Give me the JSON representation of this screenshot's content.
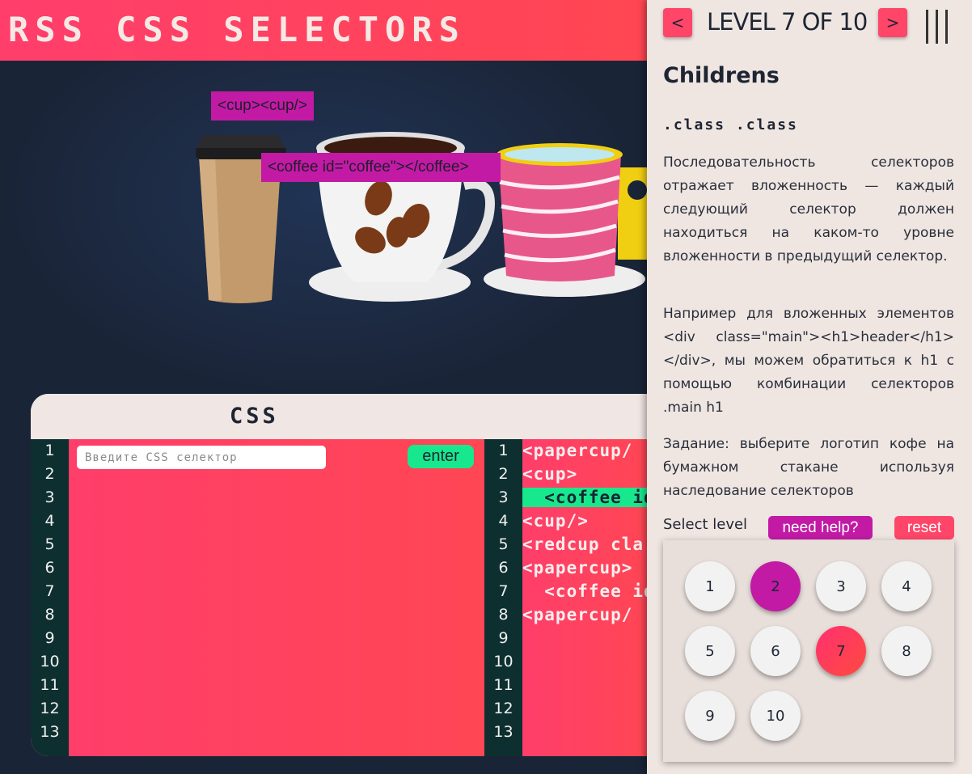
{
  "header": {
    "title": "RSS CSS SELECTORS"
  },
  "stage": {
    "tooltip_cup": "<cup><cup/>",
    "tooltip_coffee": "<coffee id=\"coffee\"></coffee>"
  },
  "editor": {
    "css_title": "CSS",
    "line_numbers": [
      "1",
      "2",
      "3",
      "4",
      "5",
      "6",
      "7",
      "8",
      "9",
      "10",
      "11",
      "12",
      "13"
    ],
    "input_placeholder": "Введите CSS селектор",
    "enter_label": "enter",
    "html_lines": [
      "<papercup/",
      "<cup>",
      "  <coffee id",
      "<cup/>",
      "<redcup cla",
      "<papercup>",
      "  <coffee id",
      "<papercup/"
    ]
  },
  "panel": {
    "prev_label": "<",
    "next_label": ">",
    "level_title": "LEVEL 7 OF 10",
    "menu_icon": "menu-icon",
    "level_name": "Childrens",
    "selector": ".class .class",
    "para1": "Последовательность селекторов отражает вложенность — каждый следующий селектор должен находиться на каком-то уровне вложенности в предыдущий селектор.",
    "para2": "Например для вложенных элементов <div class=\"main\"><h1>header</h1></div>, мы можем обратиться к h1 с помощью комбинации селекторов .main h1",
    "para3": "Задание: выберите логотип кофе на бумажном стакане используя наследование селекторов",
    "select_label": "Select level",
    "help_label": "need help?",
    "reset_label": "reset",
    "levels": [
      "1",
      "2",
      "3",
      "4",
      "5",
      "6",
      "7",
      "8",
      "9",
      "10"
    ],
    "completed_level": "2",
    "current_level": "7"
  },
  "colors": {
    "accent_pink": "#ff4669",
    "accent_magenta": "#c21aa5",
    "accent_green": "#18e88d",
    "background_dark": "#1a2437",
    "panel_bg": "#efe6e2"
  }
}
